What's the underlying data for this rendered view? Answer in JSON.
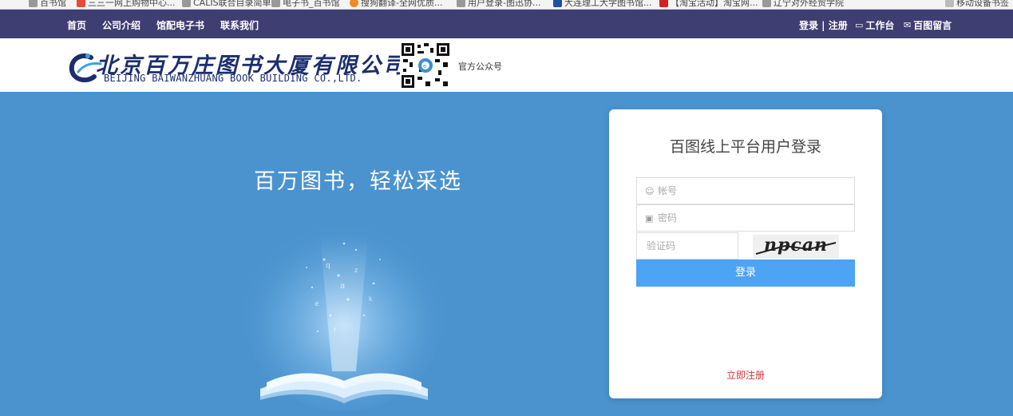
{
  "bookmarks": [
    {
      "label": "百书馆",
      "color": "#999"
    },
    {
      "label": "三三一网上购物中心...",
      "color": "#e84b3c"
    },
    {
      "label": "CALIS联合目录简单...",
      "color": "#999"
    },
    {
      "label": "电子书_百书馆",
      "color": "#999"
    },
    {
      "label": "搜狗翻译-全网优质...",
      "color": "#f08a24"
    },
    {
      "label": "用户登录-图迅协...",
      "color": "#999"
    },
    {
      "label": "大连理工大学图书馆...",
      "color": "#1f4f9f"
    },
    {
      "label": "【淘宝活动】淘宝网...",
      "color": "#d62020"
    },
    {
      "label": "辽宁对外经贸学院",
      "color": "#999"
    },
    {
      "label": "移动设备书签",
      "color": "#999"
    }
  ],
  "nav": {
    "home": "首页",
    "about": "公司介绍",
    "ebooks": "馆配电子书",
    "contact": "联系我们",
    "login_register": "登录 | 注册",
    "workbench": "工作台",
    "messages": "百图留言"
  },
  "header": {
    "company_cn": "北京百万庄图书大厦有限公司",
    "company_en": "BEIJING BAIWANZHUANG BOOK BUILDING CO.,LTD.",
    "qr_label": "官方公众号"
  },
  "hero": {
    "slogan": "百万图书，轻松采选"
  },
  "login": {
    "title": "百图线上平台用户登录",
    "account_placeholder": "帐号",
    "password_placeholder": "密码",
    "captcha_placeholder": "验证码",
    "captcha_text": "npcan",
    "submit": "登录",
    "register": "立即注册"
  },
  "colors": {
    "nav_bg": "#3e3e72",
    "hero_bg": "#4a93cf",
    "login_button": "#4da3f4",
    "register_link": "#e03030",
    "brand": "#1c2e6e"
  }
}
